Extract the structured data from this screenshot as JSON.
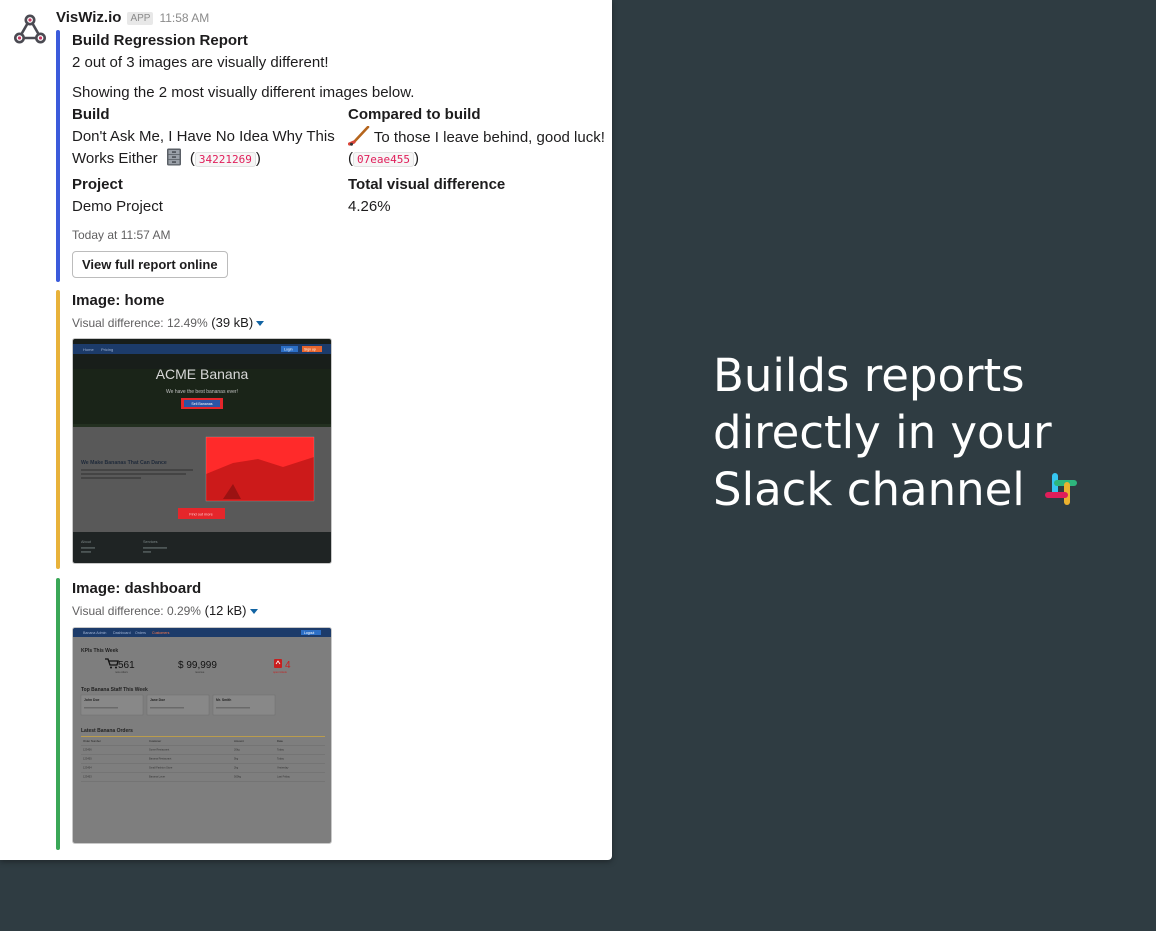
{
  "message": {
    "app_name": "VisWiz.io",
    "app_badge": "APP",
    "time": "11:58 AM"
  },
  "report": {
    "title": "Build Regression Report",
    "summary": "2 out of 3 images are visually different!",
    "showing": "Showing the 2 most visually different images below.",
    "build_label": "Build",
    "build_line1": "Don't Ask Me, I Have No Idea Why This",
    "build_line2": "Works Either",
    "build_hash": "34221269",
    "compared_label": "Compared to build",
    "compared_text": "To those I leave behind, good luck!",
    "compared_hash": "07eae455",
    "project_label": "Project",
    "project_value": "Demo Project",
    "diff_label": "Total visual difference",
    "diff_value": "4.26%",
    "footer_time": "Today at 11:57 AM",
    "button_label": "View full report online"
  },
  "images": [
    {
      "title": "Image: home",
      "diff_text": "Visual difference: 12.49%",
      "size": "(39 kB)",
      "thumb": {
        "nav_items": [
          "Home",
          "Pricing"
        ],
        "nav_buttons": [
          "Login",
          "Sign up"
        ],
        "hero_title": "ACME Banana",
        "hero_subtitle": "We have the best bananas ever!",
        "hero_button": "Sell Bananas",
        "section_title": "We Make Bananas That Can Dance",
        "section_text": "Yes that's right, you thought it was the stuff of dreams, but even bananas can be bioengineered.",
        "section_button": "Find out more",
        "footer_cols": [
          "About",
          "Services"
        ]
      }
    },
    {
      "title": "Image: dashboard",
      "diff_text": "Visual difference: 0.29%",
      "size": "(12 kB)",
      "thumb": {
        "nav_items": [
          "Banana Admin",
          "Dashboard",
          "Orders",
          "Customers"
        ],
        "nav_button": "Logout",
        "kpi_title": "KPIs This Week",
        "kpis": [
          {
            "value": "561",
            "label": "new orders"
          },
          {
            "value": "$ 99,999",
            "label": "revenue"
          },
          {
            "value": "4",
            "label": "open tickets"
          }
        ],
        "staff_title": "Top Banana Staff This Week",
        "staff": [
          "John Doe",
          "Jane Doe",
          "Mr. Smith"
        ],
        "orders_title": "Latest Banana Orders",
        "order_headers": [
          "Order Number",
          "Customer",
          "Amount",
          "Date"
        ],
        "order_rows": [
          [
            "123456",
            "Some Restaurant",
            "20kg",
            "Today"
          ],
          [
            "123455",
            "Banana Restaurant",
            "5kg",
            "Today"
          ],
          [
            "123454",
            "Small Fashion Store",
            "2kg",
            "Yesterday"
          ],
          [
            "123453",
            "Banana Lover",
            "500kg",
            "Last Friday"
          ]
        ]
      }
    }
  ],
  "headline": {
    "line1": "Builds reports",
    "line2": "directly in your",
    "line3": "Slack channel"
  },
  "colors": {
    "background": "#2f3c42",
    "attachment_report": "#3b5bdb",
    "attachment_home": "#e8b23a",
    "attachment_dashboard": "#3aa757",
    "code_text": "#e01e5a",
    "diff_overlay": "#ff2020"
  },
  "icons": {
    "avatar": "webhook-icon",
    "build_emoji": "file-cabinet-icon",
    "compared_emoji": "hockey-stick-icon",
    "size_caret": "caret-down-icon",
    "slack": "slack-logo"
  }
}
